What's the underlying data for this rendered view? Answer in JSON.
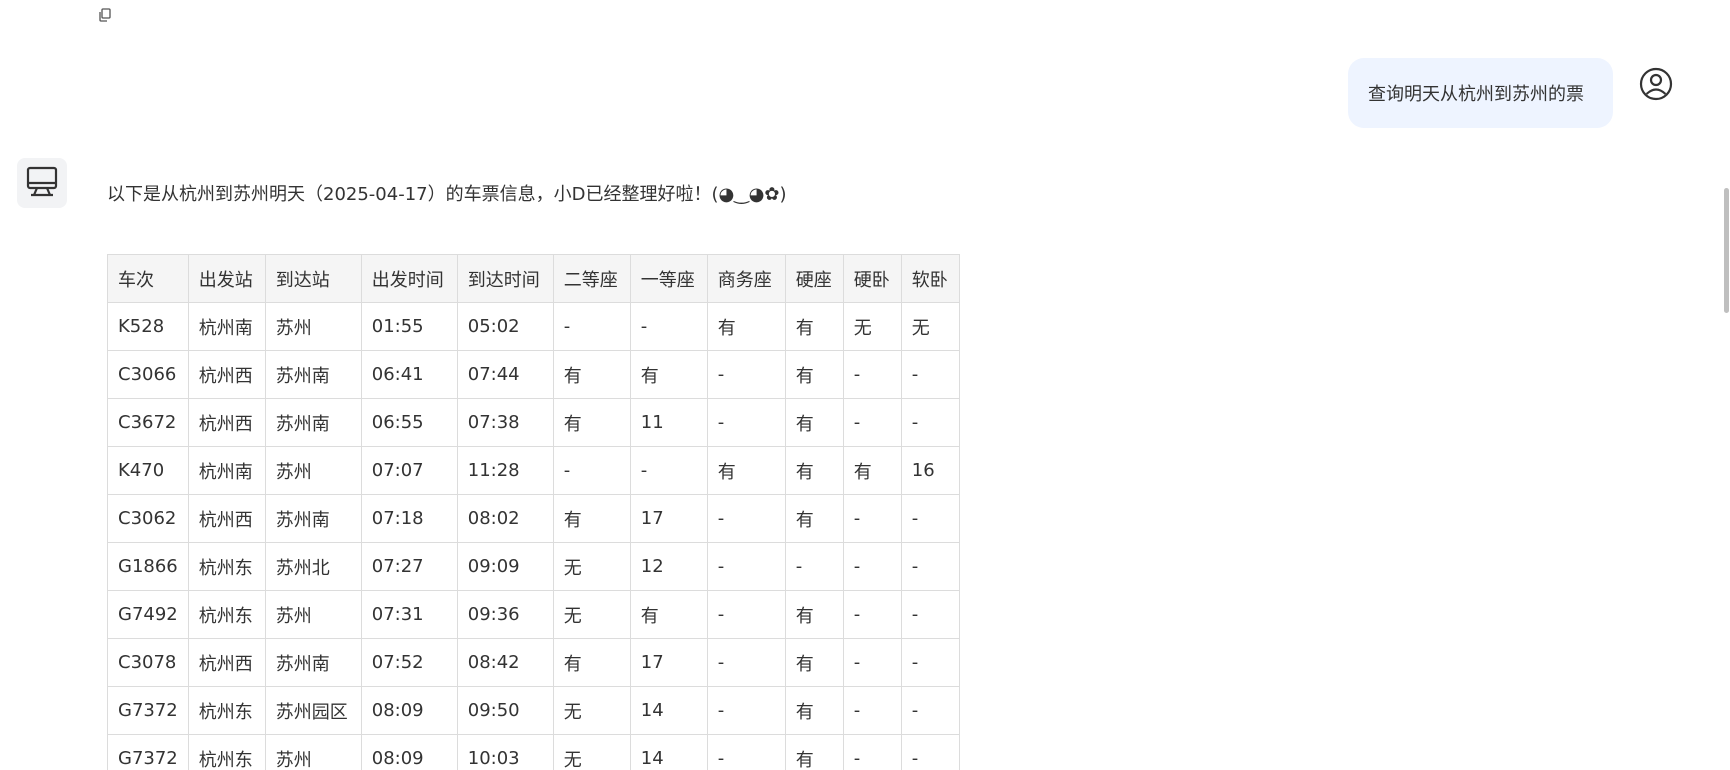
{
  "icons": {
    "copy": "copy-icon",
    "user_avatar": "user-circle-icon",
    "bot_avatar": "monitor-icon"
  },
  "user_message": {
    "text": "查询明天从杭州到苏州的票"
  },
  "bot_message": {
    "intro": "以下是从杭州到苏州明天（2025-04-17）的车票信息，小D已经整理好啦！(◕‿◕✿)"
  },
  "table": {
    "headers": [
      "车次",
      "出发站",
      "到达站",
      "出发时间",
      "到达时间",
      "二等座",
      "一等座",
      "商务座",
      "硬座",
      "硬卧",
      "软卧"
    ],
    "rows": [
      [
        "K528",
        "杭州南",
        "苏州",
        "01:55",
        "05:02",
        "-",
        "-",
        "有",
        "有",
        "无",
        "无"
      ],
      [
        "C3066",
        "杭州西",
        "苏州南",
        "06:41",
        "07:44",
        "有",
        "有",
        "-",
        "有",
        "-",
        "-"
      ],
      [
        "C3672",
        "杭州西",
        "苏州南",
        "06:55",
        "07:38",
        "有",
        "11",
        "-",
        "有",
        "-",
        "-"
      ],
      [
        "K470",
        "杭州南",
        "苏州",
        "07:07",
        "11:28",
        "-",
        "-",
        "有",
        "有",
        "有",
        "16"
      ],
      [
        "C3062",
        "杭州西",
        "苏州南",
        "07:18",
        "08:02",
        "有",
        "17",
        "-",
        "有",
        "-",
        "-"
      ],
      [
        "G1866",
        "杭州东",
        "苏州北",
        "07:27",
        "09:09",
        "无",
        "12",
        "-",
        "-",
        "-",
        "-"
      ],
      [
        "G7492",
        "杭州东",
        "苏州",
        "07:31",
        "09:36",
        "无",
        "有",
        "-",
        "有",
        "-",
        "-"
      ],
      [
        "C3078",
        "杭州西",
        "苏州南",
        "07:52",
        "08:42",
        "有",
        "17",
        "-",
        "有",
        "-",
        "-"
      ],
      [
        "G7372",
        "杭州东",
        "苏州园区",
        "08:09",
        "09:50",
        "无",
        "14",
        "-",
        "有",
        "-",
        "-"
      ],
      [
        "G7372",
        "杭州东",
        "苏州",
        "08:09",
        "10:03",
        "无",
        "14",
        "-",
        "有",
        "-",
        "-"
      ]
    ]
  }
}
